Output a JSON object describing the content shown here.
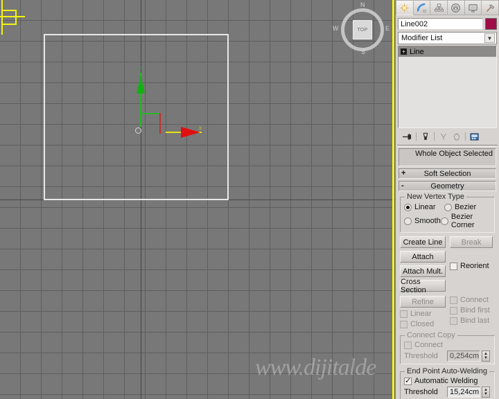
{
  "viewport": {
    "label": "viewport-top-view",
    "viewcube": {
      "face_label": "TOP",
      "north": "N",
      "south": "S",
      "west": "W",
      "east": "E"
    },
    "gizmo": {
      "x_label": "x",
      "y_label": "y"
    },
    "watermark": "www.dijitalde",
    "grid_color": "#5e5e5e",
    "background_color": "#787878",
    "shape_color": "#e8e8e8",
    "selection_color": "#f5f50c"
  },
  "command_panel": {
    "tabs": [
      {
        "name": "create-tab",
        "icon": "star-icon",
        "active": false
      },
      {
        "name": "modify-tab",
        "icon": "arc-bend-icon",
        "active": true
      },
      {
        "name": "hierarchy-tab",
        "icon": "hierarchy-nodes-icon",
        "active": false
      },
      {
        "name": "motion-tab",
        "icon": "motion-wheel-icon",
        "active": false
      },
      {
        "name": "display-tab",
        "icon": "display-monitor-icon",
        "active": false
      },
      {
        "name": "utilities-tab",
        "icon": "hammer-icon",
        "active": false
      }
    ],
    "object_name": "Line002",
    "object_color": "#9e0d47",
    "modifier_list_label": "Modifier List",
    "modifier_stack": [
      {
        "label": "Line",
        "selected": true,
        "expandable": true,
        "expand_sign": "+"
      }
    ],
    "stack_tools": [
      "pin-stack-icon",
      "show-end-result-icon",
      "make-unique-icon",
      "remove-modifier-icon",
      "configure-modifier-sets-icon"
    ],
    "selection_status": "Whole Object Selected",
    "rollouts": [
      {
        "name": "soft-selection",
        "title": "Soft Selection",
        "sign": "+",
        "expanded": false
      },
      {
        "name": "geometry",
        "title": "Geometry",
        "sign": "-",
        "expanded": true
      }
    ],
    "geometry": {
      "new_vertex_type": {
        "title": "New Vertex Type",
        "options": [
          {
            "label": "Linear",
            "selected": true
          },
          {
            "label": "Bezier",
            "selected": false
          },
          {
            "label": "Smooth",
            "selected": false
          },
          {
            "label": "Bezier Corner",
            "selected": false
          }
        ]
      },
      "buttons": [
        {
          "label": "Create Line",
          "enabled": true
        },
        {
          "label": "Break",
          "enabled": false
        },
        {
          "label": "Attach",
          "enabled": true
        },
        {
          "label": "Attach Mult.",
          "enabled": true
        },
        {
          "label": "Cross Section",
          "enabled": true
        }
      ],
      "reorient": {
        "label": "Reorient",
        "checked": false,
        "enabled": true
      },
      "refine": {
        "button": {
          "label": "Refine",
          "enabled": false
        },
        "checks": [
          {
            "label": "Linear",
            "checked": false,
            "enabled": false
          },
          {
            "label": "Closed",
            "checked": false,
            "enabled": false
          },
          {
            "label": "Connect",
            "checked": false,
            "enabled": false
          },
          {
            "label": "Bind first",
            "checked": false,
            "enabled": false
          },
          {
            "label": "Bind last",
            "checked": false,
            "enabled": false
          }
        ]
      },
      "connect_copy": {
        "title": "Connect Copy",
        "connect": {
          "label": "Connect",
          "checked": false,
          "enabled": false
        },
        "threshold_label": "Threshold",
        "threshold_value": "0,254cm",
        "enabled": false
      },
      "end_point_auto_welding": {
        "title": "End Point Auto-Welding",
        "automatic_welding": {
          "label": "Automatic Welding",
          "checked": true
        },
        "threshold_label": "Threshold",
        "threshold_value": "15,24cm"
      }
    }
  }
}
